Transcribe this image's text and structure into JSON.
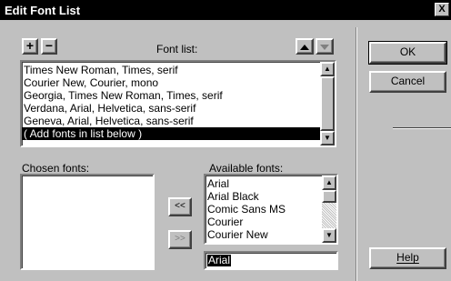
{
  "window": {
    "title": "Edit Font List",
    "close_glyph": "X"
  },
  "toolbar": {
    "add_label": "+",
    "remove_label": "−"
  },
  "font_list": {
    "label": "Font list:",
    "items": [
      "Times New Roman, Times, serif",
      "Courier New, Courier, mono",
      "Georgia, Times New Roman, Times, serif",
      "Verdana, Arial, Helvetica, sans-serif",
      "Geneva, Arial, Helvetica, sans-serif",
      "( Add fonts in list below )"
    ],
    "selected_index": 5
  },
  "chosen_fonts": {
    "label": "Chosen fonts:",
    "items": []
  },
  "transfer": {
    "add_label": "<<",
    "remove_label": ">>"
  },
  "available_fonts": {
    "label": "Available fonts:",
    "items": [
      "Arial",
      "Arial Black",
      "Comic Sans MS",
      "Courier",
      "Courier New"
    ],
    "input_value": "Arial"
  },
  "buttons": {
    "ok": "OK",
    "cancel": "Cancel",
    "help": "Help"
  }
}
